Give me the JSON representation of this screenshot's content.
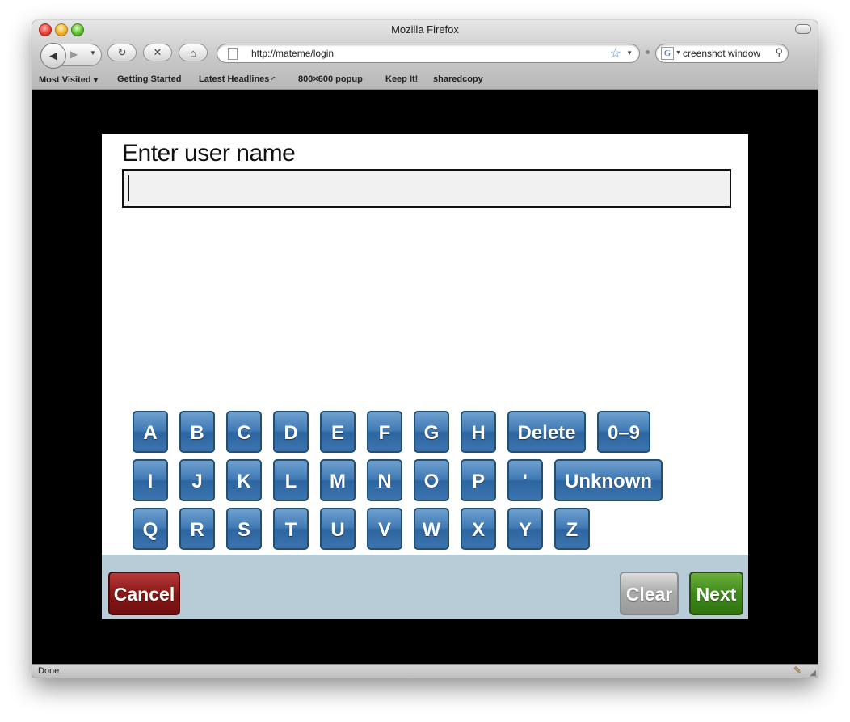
{
  "window": {
    "title": "Mozilla Firefox"
  },
  "toolbar": {
    "url": "http://mateme/login",
    "search_value": "creenshot window",
    "search_engine_glyph": "G"
  },
  "bookmarks": [
    "Most Visited ▾",
    "Getting Started",
    "Latest Headlines",
    "800×600 popup",
    "Keep It!",
    "sharedcopy"
  ],
  "page": {
    "prompt": "Enter user name",
    "username_value": "",
    "keyboard": {
      "row1": [
        "A",
        "B",
        "C",
        "D",
        "E",
        "F",
        "G",
        "H",
        "Delete",
        "0–9"
      ],
      "row2": [
        "I",
        "J",
        "K",
        "L",
        "M",
        "N",
        "O",
        "P",
        "'",
        "Unknown"
      ],
      "row3": [
        "Q",
        "R",
        "S",
        "T",
        "U",
        "V",
        "W",
        "X",
        "Y",
        "Z"
      ]
    },
    "footer": {
      "cancel": "Cancel",
      "clear": "Clear",
      "next": "Next"
    }
  },
  "status": {
    "text": "Done"
  },
  "colors": {
    "key_blue": "#3f79b4",
    "cancel_red": "#8a1717",
    "clear_gray": "#a9a9a9",
    "next_green": "#3f8a1c",
    "footer_bg": "#b8ccd8"
  }
}
